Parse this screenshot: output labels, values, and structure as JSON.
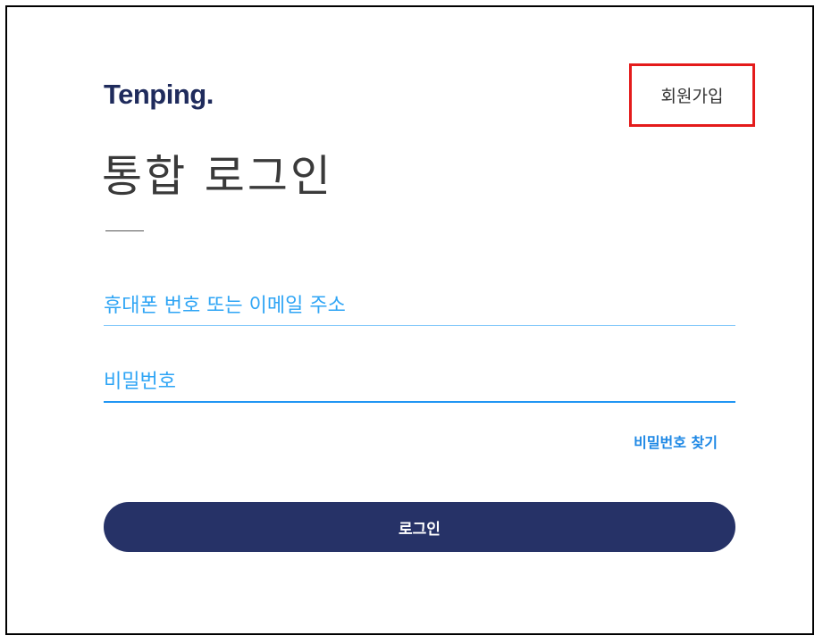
{
  "brand": {
    "logo_text": "Tenping."
  },
  "header": {
    "signup_label": "회원가입"
  },
  "page": {
    "title": "통합 로그인"
  },
  "form": {
    "phone_email_placeholder": "휴대폰 번호 또는 이메일 주소",
    "phone_email_value": "",
    "password_placeholder": "비밀번호",
    "password_value": "",
    "find_password_label": "비밀번호 찾기",
    "login_label": "로그인"
  },
  "colors": {
    "brand_navy": "#263267",
    "accent_blue": "#2196f3",
    "highlight_red": "#e41b1b"
  }
}
